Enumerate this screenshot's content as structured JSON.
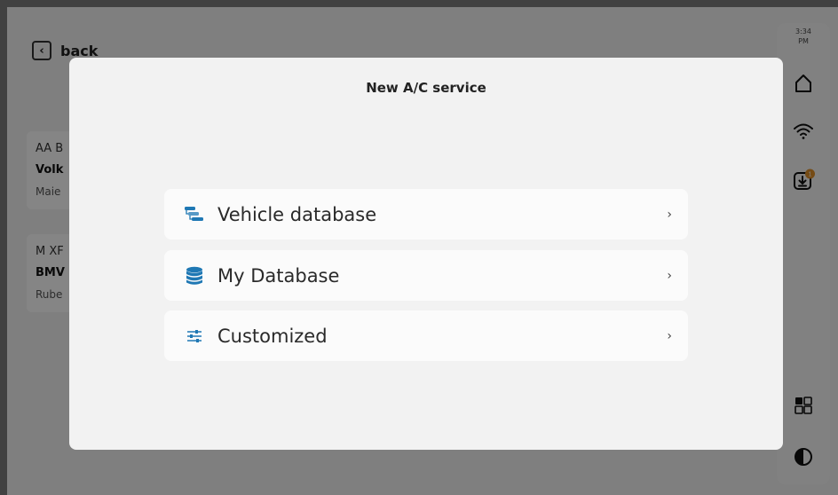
{
  "background": {
    "back_label": "back",
    "back_icon": "chevron-left-icon",
    "cards": [
      {
        "plate": "AA B",
        "model": "Volk",
        "owner": "Maie"
      },
      {
        "plate": "M XF",
        "model": "BMV",
        "owner": "Rube"
      }
    ]
  },
  "rail": {
    "time_line1": "3:34",
    "time_line2": "PM",
    "icons": [
      "home-icon",
      "wifi-icon",
      "download-icon",
      "apps-icon",
      "contrast-icon"
    ],
    "download_badge": "1"
  },
  "modal": {
    "title": "New A/C service",
    "options": [
      {
        "label": "Vehicle database",
        "icon": "vehicle-database-icon"
      },
      {
        "label": "My Database",
        "icon": "database-icon"
      },
      {
        "label": "Customized",
        "icon": "sliders-icon"
      }
    ],
    "chevron": "›"
  },
  "colors": {
    "accent": "#1f78b4",
    "badge": "#e0912a",
    "overlay": "rgba(0,0,0,0.48)"
  }
}
